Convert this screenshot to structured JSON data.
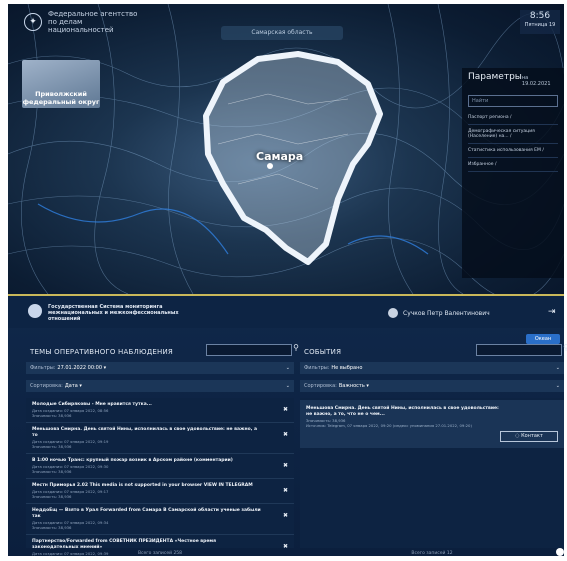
{
  "map": {
    "agency_line1": "Федеральное агентство",
    "agency_line2": "по делам национальностей",
    "region_selector": "Самарская область",
    "time": "8:56",
    "date": "Пятница 19",
    "district_label": "Приволжский федеральный округ",
    "city_label": "Самара",
    "params": {
      "title": "Параметры",
      "date": "на 19.02.2021",
      "search_placeholder": "Найти",
      "items": [
        "Паспорт региона /",
        "Демографическая ситуация (Население) на... /",
        "Статистика использования ЕМ /",
        "Избранное /"
      ]
    }
  },
  "dashboard": {
    "system_title": "Государственная Система мониторинга межнациональных и межконфессиональных отношений",
    "user_name": "Сучков Петр Валентинович",
    "new_button": "Океан",
    "left": {
      "title": "ТЕМЫ ОПЕРАТИВНОГО НАБЛЮДЕНИЯ",
      "filter_label": "Фильтры:",
      "filter_value": "27.01.2022 00:00 ▾",
      "sort_label": "Сортировка:",
      "sort_value": "Дата ▾",
      "items": [
        {
          "title": "Молодые Сибиряковы - Мне нравится тутка...",
          "meta1": "Дата создания: 07 января 2022, 08:56",
          "meta2": "Значимость: 38,936"
        },
        {
          "title": "Меньшова Смирна. День святой Нины, исполнилась в свое удовольствие: не важно, а то",
          "meta1": "Дата создания: 07 января 2022, 09:19",
          "meta2": "Значимость: 38,936"
        },
        {
          "title": "В 1:00 ночью Транс: крупный пожар возник в Арском районе (комментарии)",
          "meta1": "Дата создания: 07 января 2022, 09:30",
          "meta2": "Значимость: 38,936"
        },
        {
          "title": "Местн Приморья 2.02 This media is not supported in your browser VIEW IN TELEGRAM",
          "meta1": "Дата создания: 07 января 2022, 09:17",
          "meta2": "Значимость: 38,936"
        },
        {
          "title": "НеддоЕщ — Взято в Урал Forwarded from Самара В Самарской области ученые забыли так",
          "meta1": "Дата создания: 07 января 2022, 09:34",
          "meta2": "Значимость: 38,936"
        },
        {
          "title": "Партнерство/Forwarded from СОВЕТНИК ПРЕЗИДЕНТА «Честное время законодательных мнений»",
          "meta1": "Дата создания: 07 января 2022, 09:39",
          "meta2": ""
        }
      ],
      "count": "Всего записей 258"
    },
    "right": {
      "title": "СОБЫТИЯ",
      "filter_label": "Фильтры:",
      "filter_value": "Не выбрано",
      "sort_label": "Сортировка:",
      "sort_value": "Важность ▾",
      "event": {
        "title": "Меньшова Смирна. День святой Нины, исполнилась в свое удовольствие: не важно, а то, что не о чем...",
        "meta1": "Значимость: 38,936",
        "meta2": "Источник: Telegram, 07 января 2022, 09:20 (индекс упоминания 27.01.2022, 09:20)",
        "contact_button": "Контакт"
      },
      "count": "Всего записей 12"
    }
  }
}
